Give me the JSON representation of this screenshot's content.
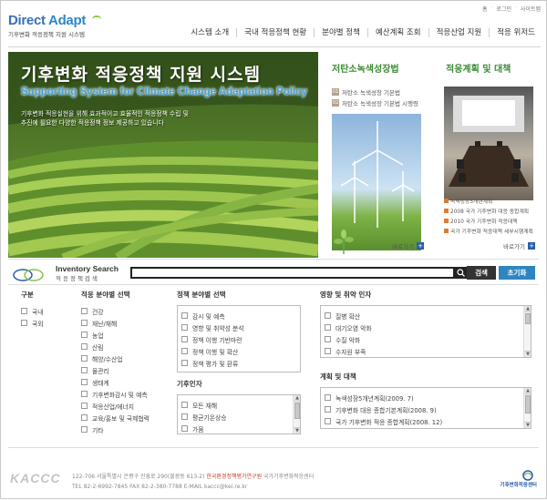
{
  "header": {
    "logo_text_1": "Direct ",
    "logo_text_2": "Adapt",
    "logo_sub": "기후변화 적응정책 지원 시스템",
    "toplinks": [
      "홈",
      "로그인",
      "사이트맵"
    ],
    "nav": [
      "시스템 소개",
      "국내 적응정책 현황",
      "분야별 정책",
      "예산계획 조회",
      "적응산업 지원",
      "적응 위저드"
    ]
  },
  "hero": {
    "title": "기후변화 적응정책 지원 시스템",
    "subtitle": "Supporting System for Climate Change Adaptation Policy",
    "desc_1": "기후변화 적응실현을 위해 효과적이고 효율적인 적응정책 수립 및",
    "desc_2": "추진에 필요한 다양한 적응정책 정보 제공하고 있습니다"
  },
  "panel1": {
    "title": "저탄소녹색성장법",
    "items": [
      {
        "num": "01",
        "label": "저탄소 녹색성장 기본법"
      },
      {
        "num": "02",
        "label": "저탄소 녹색성장 기본법 시행령"
      }
    ],
    "more": "바로가기"
  },
  "panel2": {
    "title": "적응계획 및 대책",
    "items": [
      "녹색성장5개년계획",
      "2008 국가 기후변화 대응 종합계획",
      "2010 국가 기후변화 적응대책",
      "국가 기후변화 적응대책 세부시행계획"
    ],
    "more": "바로가기"
  },
  "search": {
    "title_en": "Inventory Search",
    "title_ko": "적응정책검색",
    "placeholder": "",
    "btn_search": "검색",
    "btn_reset": "초기화"
  },
  "filters": {
    "gubun": {
      "title": "구분",
      "items": [
        "국내",
        "국외"
      ]
    },
    "field": {
      "title": "적응 분야별 선택",
      "items": [
        "건강",
        "재난/재해",
        "농업",
        "산림",
        "해양/수산업",
        "물관리",
        "생태계",
        "기후변화감시 및 예측",
        "적응산업/에너지",
        "교육/홍보 및 국제협력",
        "기타"
      ]
    },
    "policy": {
      "title": "정책 분야별 선택",
      "items": [
        "감시 및 예측",
        "영향 및 취약성 분석",
        "정책 이행 기반마련",
        "정책 이행 및 확산",
        "정책 평가 및 환류"
      ]
    },
    "climate": {
      "title": "기후인자",
      "items": [
        "모든 재해",
        "평균기온상승",
        "가뭄"
      ]
    },
    "impact": {
      "title": "영향 및 취약 인자",
      "items": [
        "질병 확산",
        "대기오염 악화",
        "수질 악화",
        "수자원 부족"
      ]
    },
    "plan": {
      "title": "계획 및 대책",
      "items": [
        "녹색성장5개년계획(2009. 7)",
        "기후변화 대응 종합기본계획(2008. 9)",
        "국가 기후변화 적응 종합계획(2008. 12)"
      ]
    }
  },
  "footer": {
    "brand": "KACCC",
    "line1_a": "122-706 서울특별시 은평구 진흥로 290(불광동 613-2) ",
    "line1_b": "한국환경정책평가연구원",
    "line1_c": " 국가기후변화적응센터",
    "line2": "TEL 82-2-6992-7845  FAX 82-2-380-7788  E-MAIL kaccc@kei.re.kr",
    "logo_caption": "기후변화적응센터"
  },
  "colors": {
    "brand_blue": "#2a5ea8",
    "green_title": "#3d8b37",
    "reset_btn": "#2e86c1",
    "accent_orange": "#e07b32"
  }
}
